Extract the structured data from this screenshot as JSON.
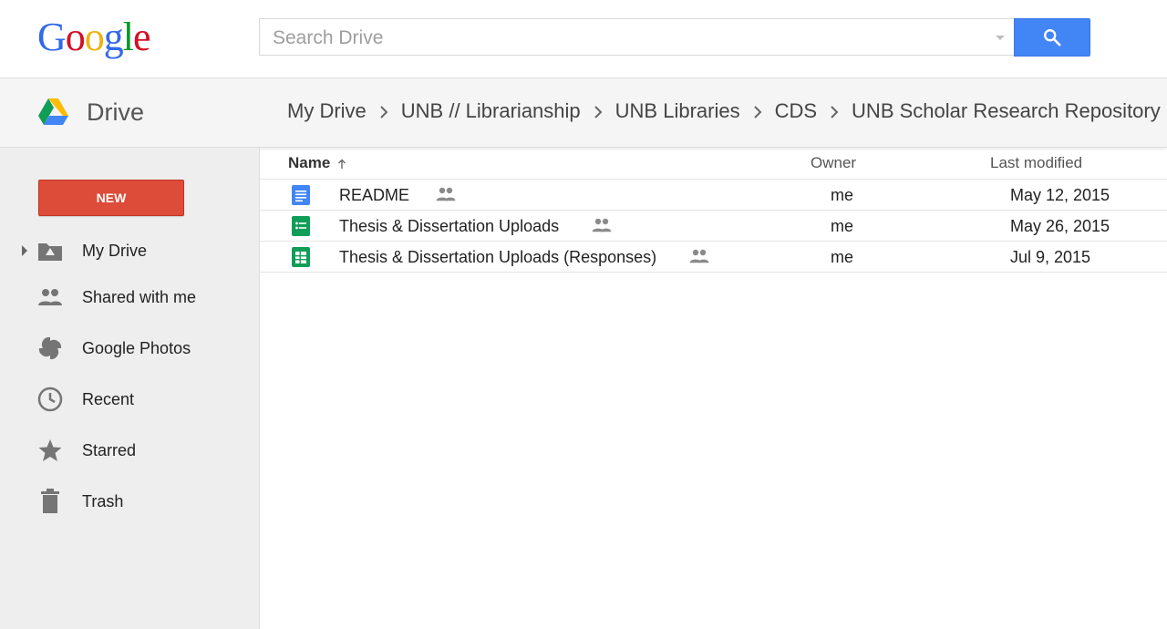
{
  "header": {
    "logo_letters": [
      "G",
      "o",
      "o",
      "g",
      "l",
      "e"
    ],
    "logo_colors": [
      "#3369e8",
      "#d50f25",
      "#eeb211",
      "#3369e8",
      "#009925",
      "#d50f25"
    ],
    "search_placeholder": "Search Drive",
    "search_button_icon": "search-icon"
  },
  "drivebar": {
    "title": "Drive",
    "breadcrumbs": [
      "My Drive",
      "UNB // Librarianship",
      "UNB Libraries",
      "CDS",
      "UNB Scholar Research Repository"
    ]
  },
  "sidebar": {
    "new_label": "NEW",
    "items": [
      {
        "label": "My Drive",
        "icon": "my-drive-icon"
      },
      {
        "label": "Shared with me",
        "icon": "shared-people-icon"
      },
      {
        "label": "Google Photos",
        "icon": "photos-pinwheel-icon"
      },
      {
        "label": "Recent",
        "icon": "clock-icon"
      },
      {
        "label": "Starred",
        "icon": "star-icon"
      },
      {
        "label": "Trash",
        "icon": "trash-icon"
      }
    ]
  },
  "list": {
    "columns": {
      "name": "Name",
      "owner": "Owner",
      "modified": "Last modified"
    },
    "sort": "ascending",
    "rows": [
      {
        "name": "README",
        "type": "docs",
        "shared": true,
        "owner": "me",
        "modified": "May 12, 2015"
      },
      {
        "name": "Thesis & Dissertation Uploads",
        "type": "forms",
        "shared": true,
        "owner": "me",
        "modified": "May 26, 2015"
      },
      {
        "name": "Thesis & Dissertation Uploads (Responses)",
        "type": "sheets",
        "shared": true,
        "owner": "me",
        "modified": "Jul 9, 2015"
      }
    ]
  },
  "colors": {
    "accent_blue": "#4285f4",
    "new_button_red": "#dd4b39",
    "docs_blue": "#4285f4",
    "forms_green": "#0f9d58",
    "sheets_green": "#0f9d58"
  }
}
